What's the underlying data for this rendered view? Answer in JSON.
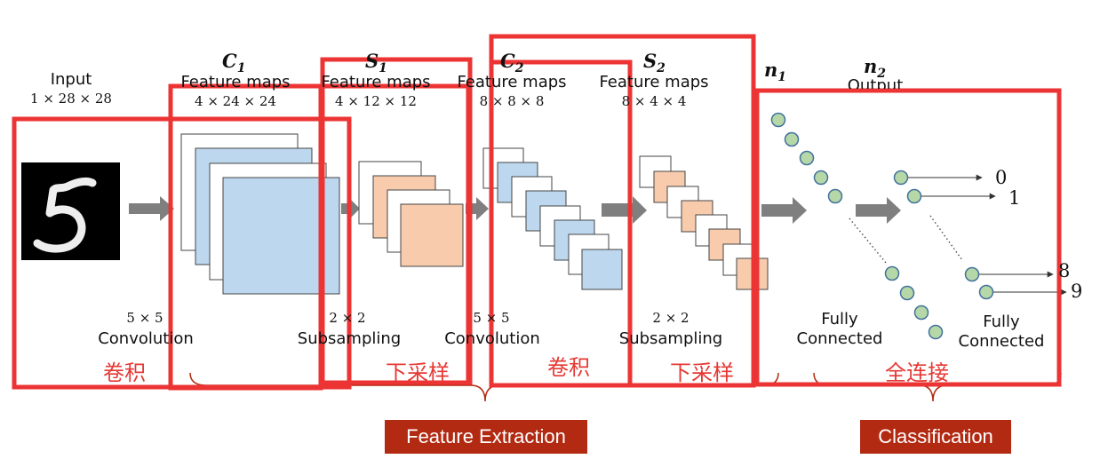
{
  "colors": {
    "frame": "#ec3434",
    "arrow": "#7f7f7f",
    "c1_map": "#bdd7ee",
    "s1_map": "#f8cbad",
    "node_fill": "#b6d7a8",
    "node_stroke": "#41719c",
    "banner_bg": "#b22a12",
    "chinese_text": "#e53935"
  },
  "input": {
    "label": "Input",
    "dims": "1 × 28 × 28",
    "digit": "5"
  },
  "layers": {
    "c1": {
      "symbol": "C",
      "sub": "1",
      "label": "Feature maps",
      "dims": "4 × 24 × 24"
    },
    "s1": {
      "symbol": "S",
      "sub": "1",
      "label": "Feature maps",
      "dims": "4 × 12 × 12"
    },
    "c2": {
      "symbol": "C",
      "sub": "2",
      "label": "Feature maps",
      "dims": "8 × 8 × 8"
    },
    "s2": {
      "symbol": "S",
      "sub": "2",
      "label": "Feature maps",
      "dims": "8 × 4 × 4"
    },
    "n1": {
      "symbol": "n",
      "sub": "1"
    },
    "n2": {
      "symbol": "n",
      "sub": "2",
      "label": "Output"
    }
  },
  "operations": [
    {
      "size": "5 × 5",
      "name": "Convolution",
      "cn": "卷积"
    },
    {
      "size": "2 × 2",
      "name": "Subsampling",
      "cn": "下采样"
    },
    {
      "size": "5 × 5",
      "name": "Convolution",
      "cn": "卷积"
    },
    {
      "size": "2 × 2",
      "name": "Subsampling",
      "cn": "下采样"
    },
    {
      "size": "",
      "name": "Fully Connected",
      "cn": "全连接"
    },
    {
      "size": "",
      "name": "Fully Connected",
      "cn": ""
    }
  ],
  "fc_lines": [
    "Fully",
    "Connected"
  ],
  "outputs": [
    "0",
    "1",
    "8",
    "9"
  ],
  "sections": {
    "feature_extraction": "Feature Extraction",
    "classification": "Classification"
  }
}
